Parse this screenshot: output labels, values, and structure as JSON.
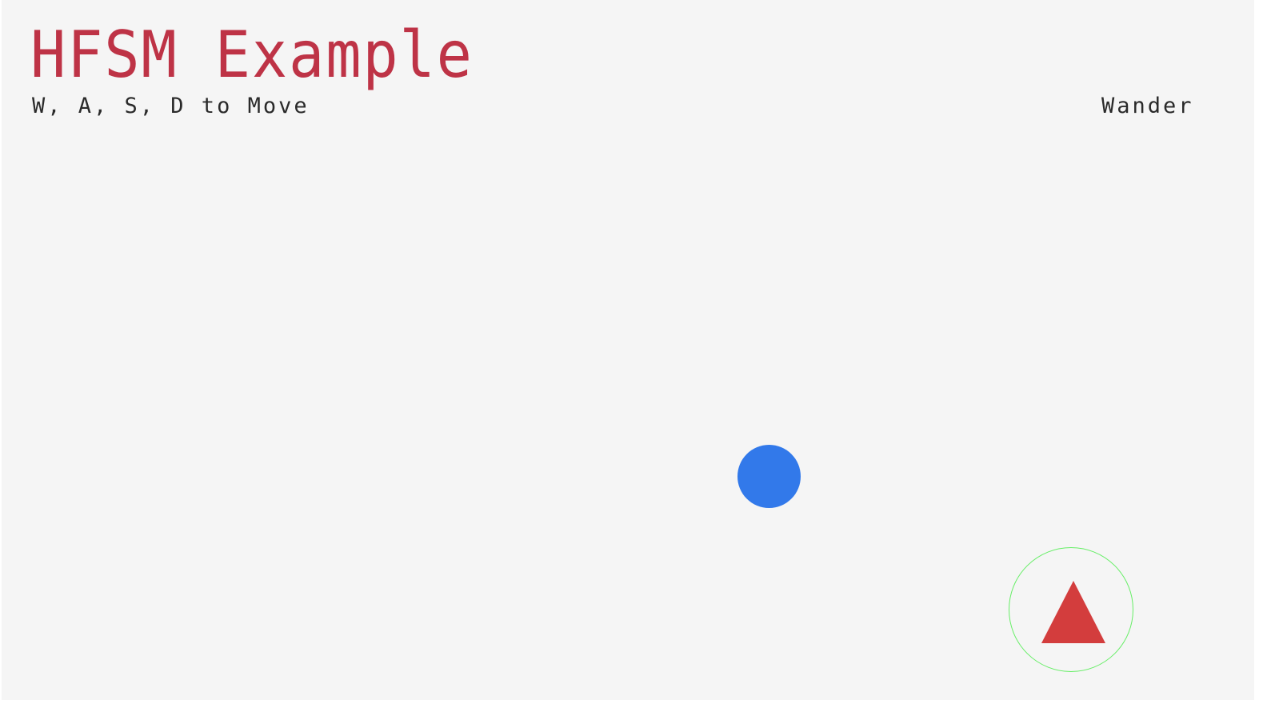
{
  "hud": {
    "title": "HFSM Example",
    "controls_hint": "W, A, S, D to Move",
    "current_state": "Wander"
  },
  "colors": {
    "background": "#f5f5f5",
    "title": "#be3346",
    "text": "#2a2a2a",
    "player": "#3279ea",
    "enemy": "#d33d3d",
    "detection_ring": "#66ee66"
  },
  "entities": {
    "player": {
      "shape": "circle"
    },
    "enemy": {
      "shape": "triangle"
    },
    "detection_ring": {
      "shape": "circle-outline"
    }
  }
}
